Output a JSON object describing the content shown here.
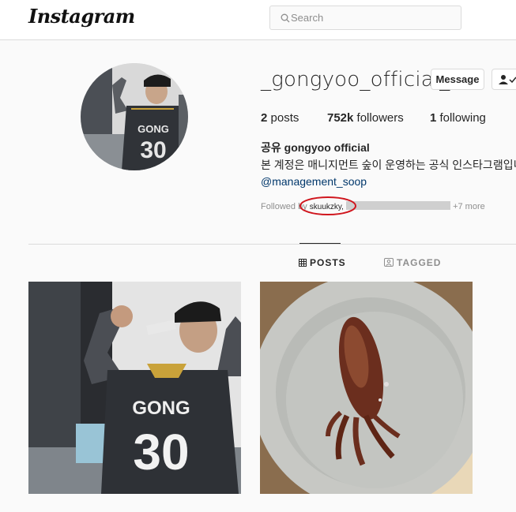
{
  "header": {
    "logo": "Instagram",
    "search_placeholder": "Search"
  },
  "profile": {
    "username": "_gongyoo_official_",
    "message_label": "Message",
    "stats": {
      "posts_count": "2",
      "posts_label": "posts",
      "followers_count": "752k",
      "followers_label": "followers",
      "following_count": "1",
      "following_label": "following"
    },
    "full_name": "공유 gongyoo official",
    "bio": "본 계정은 매니지먼트 숲이 운영하는 공식 인스타그램입니다",
    "mention": "@management_soop",
    "followed_by_prefix": "Followed by",
    "followed_by_name": "skuukzky,",
    "followed_by_more": "+7 more"
  },
  "tabs": {
    "posts": "POSTS",
    "tagged": "TAGGED"
  },
  "posts": [
    {
      "jersey_name": "GONG",
      "jersey_number": "30"
    },
    {
      "jersey_name": "",
      "jersey_number": ""
    }
  ],
  "colors": {
    "accent_link": "#00376b",
    "annotation_red": "#d0161e",
    "border": "#dbdbdb"
  }
}
